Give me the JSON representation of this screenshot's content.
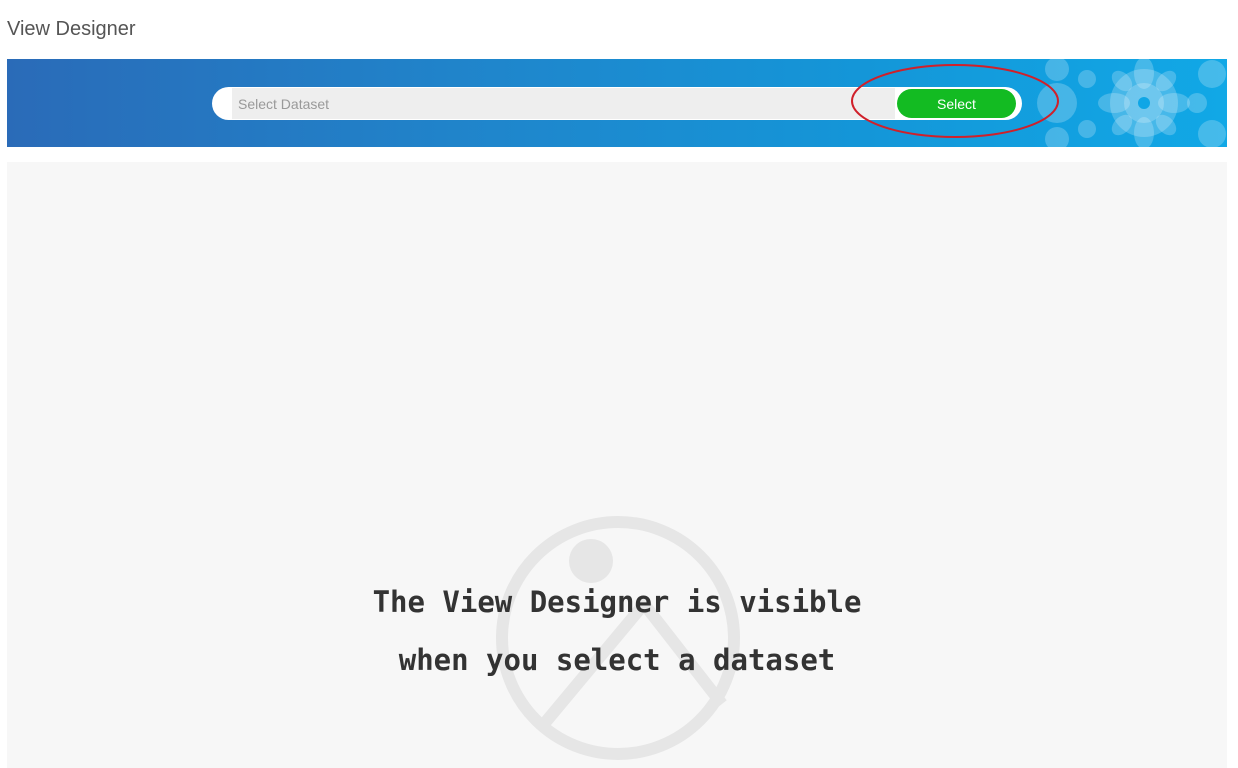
{
  "page": {
    "title": "View Designer"
  },
  "dataset_selector": {
    "placeholder": "Select Dataset",
    "value": "",
    "button_label": "Select"
  },
  "empty_state": {
    "line1": "The View Designer is visible",
    "line2": "when you select a dataset"
  },
  "colors": {
    "banner_start": "#2a6bb8",
    "banner_end": "#11a8e6",
    "select_button": "#13bb22",
    "highlight_annotation": "#d0202a",
    "content_background": "#f7f7f7"
  },
  "icons": {
    "banner_decoration": "floral-pattern",
    "empty_state_graphic": "image-placeholder-icon"
  }
}
